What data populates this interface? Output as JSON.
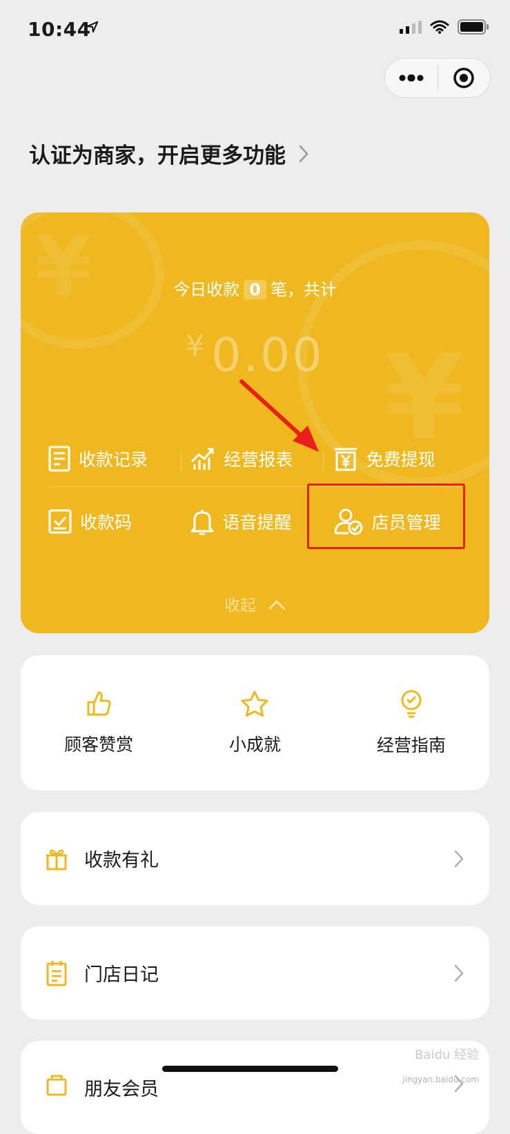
{
  "status": {
    "time": "10:44"
  },
  "banner": {
    "text": "认证为商家，开启更多功能"
  },
  "card": {
    "today_prefix": "今日收款",
    "today_count": "0",
    "today_suffix": "笔，共计",
    "currency": "¥",
    "amount": "0.00",
    "row1": [
      "收款记录",
      "经营报表",
      "免费提现"
    ],
    "row2": [
      "收款码",
      "语音提醒",
      "店员管理"
    ],
    "collapse": "收起"
  },
  "features": [
    "顾客赞赏",
    "小成就",
    "经营指南"
  ],
  "list": [
    "收款有礼",
    "门店日记",
    "朋友会员"
  ],
  "watermark": {
    "brand": "Baidu 经验",
    "url": "jingyan.baidu.com"
  },
  "colors": {
    "accent": "#eeb81e",
    "highlight": "#e8201c",
    "background": "#ededed"
  }
}
